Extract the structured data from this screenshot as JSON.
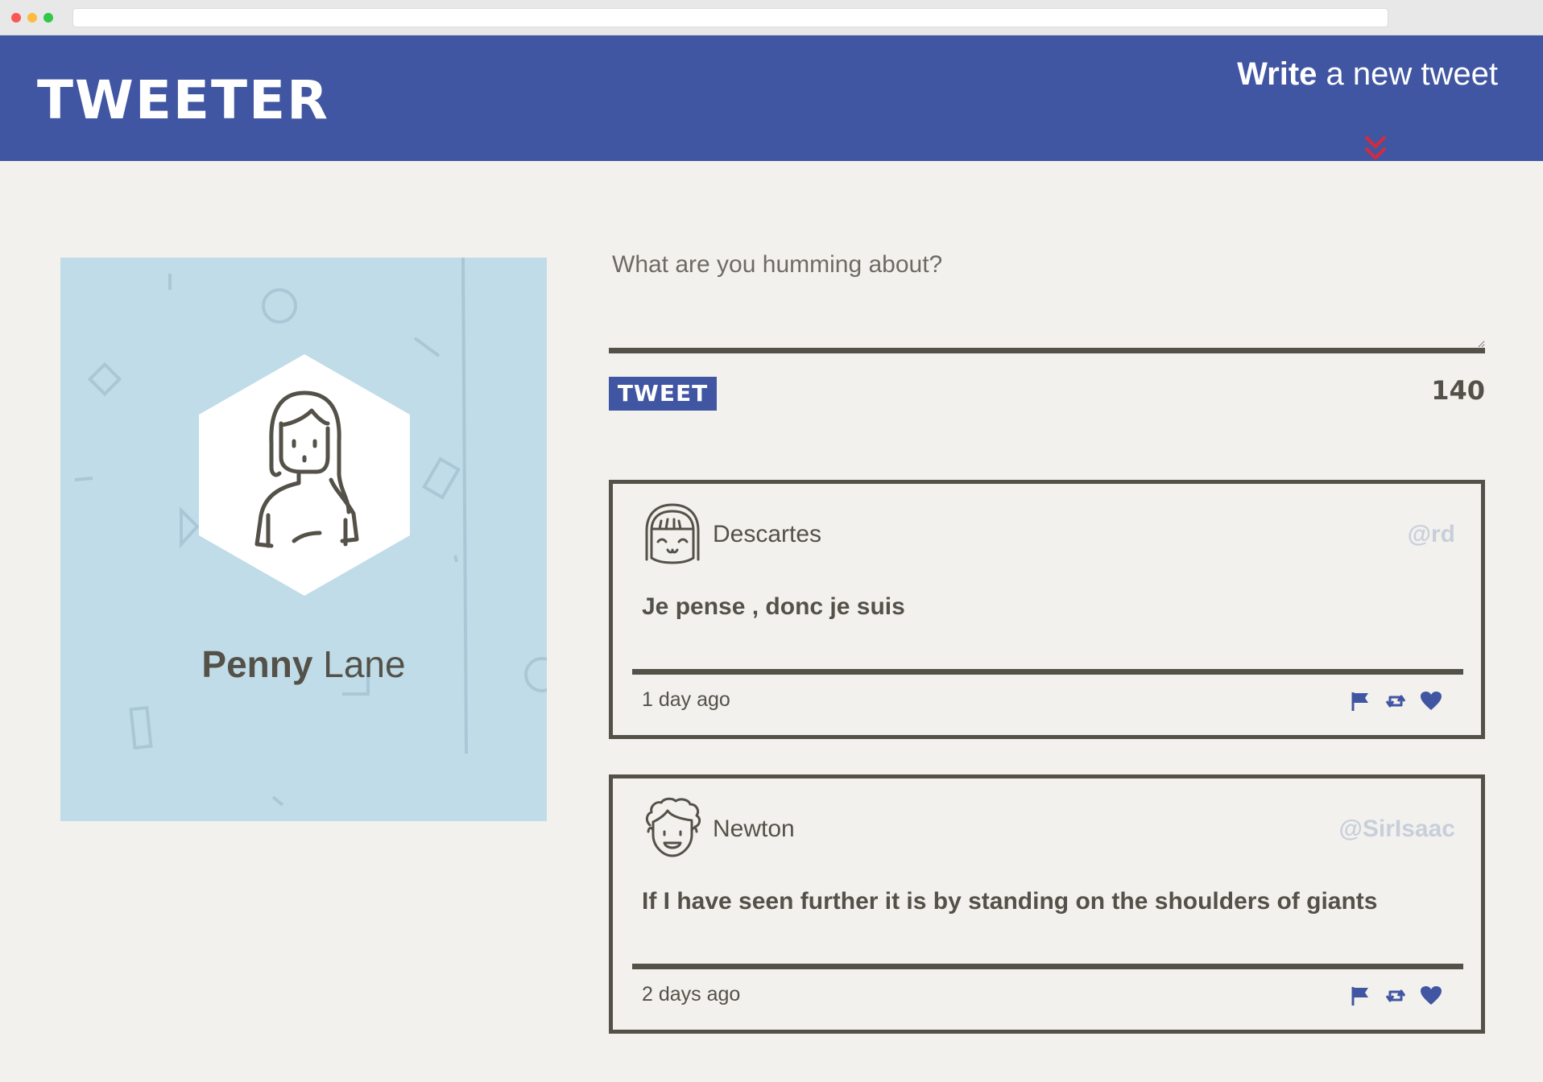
{
  "header": {
    "logo": "TWEETER",
    "compose_toggle_bold": "Write",
    "compose_toggle_rest": " a new tweet",
    "chevron_icon": "double-chevron-down-icon"
  },
  "profile": {
    "first_name": "Penny",
    "last_name": "Lane",
    "background": "#c0dce8"
  },
  "compose": {
    "placeholder": "What are you humming about?",
    "button_label": "TWEET",
    "counter": "140"
  },
  "tweets": [
    {
      "author": "Descartes",
      "handle": "@rd",
      "body": "Je pense , donc je suis",
      "time": "1 day ago",
      "avatar_icon": "girl-avatar-icon"
    },
    {
      "author": "Newton",
      "handle": "@SirIsaac",
      "body": "If I have seen further it is by standing on the shoulders of giants",
      "time": "2 days ago",
      "avatar_icon": "curly-hair-avatar-icon"
    }
  ],
  "tweet_actions": [
    "flag-icon",
    "retweet-icon",
    "heart-icon"
  ],
  "colors": {
    "brand": "#4156a2",
    "accent": "#d52b3a",
    "text": "#545149",
    "page_bg": "#f2f1ed",
    "handle": "#c8cfdb"
  }
}
